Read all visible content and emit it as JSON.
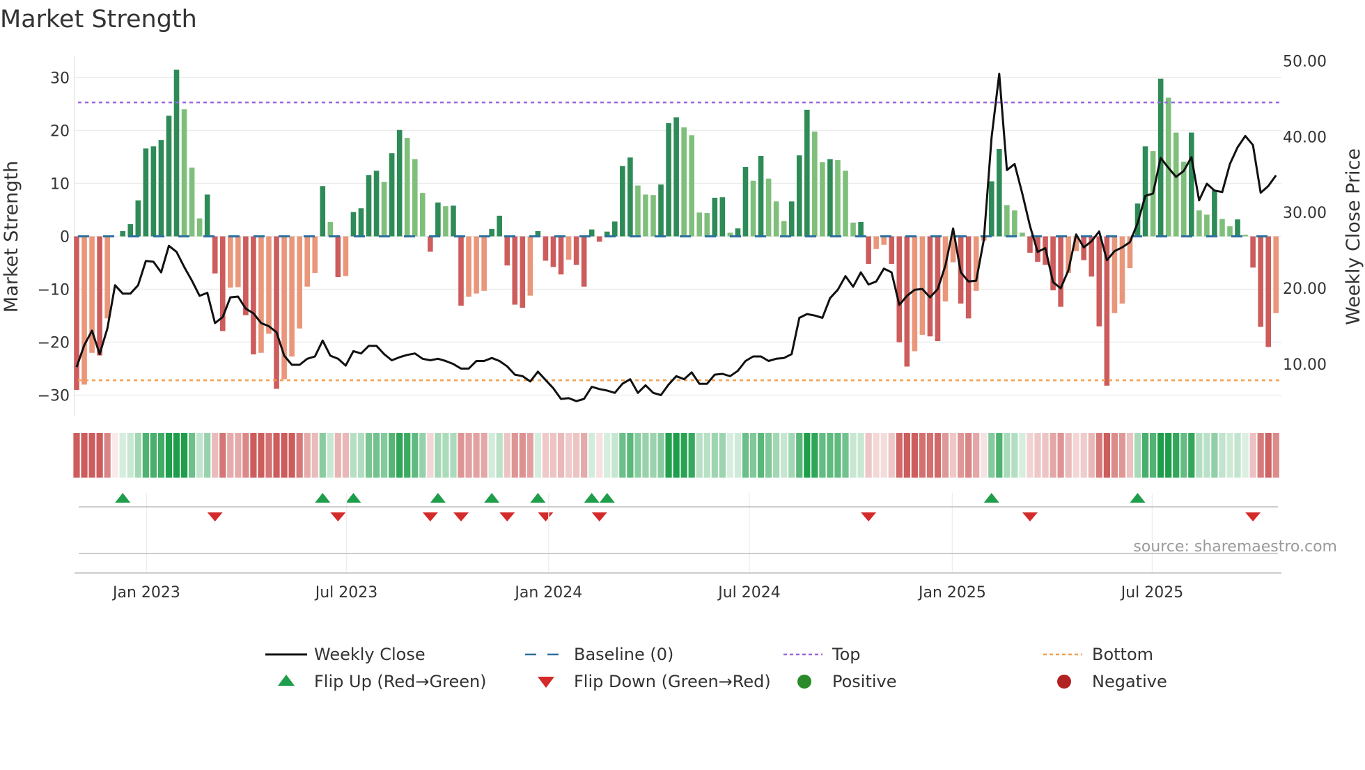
{
  "title": "Market Strength",
  "source": "source: sharemaestro.com",
  "chart_data": {
    "type": "bar",
    "title": "Market Strength",
    "ylabel": "Market Strength",
    "ylabel_right": "Weekly Close Price",
    "ylim": [
      -34,
      34
    ],
    "ylim_right": [
      3.1,
      50.6
    ],
    "grid": true,
    "left_ticks": [
      {
        "v": 30,
        "label": "30"
      },
      {
        "v": 20,
        "label": "20"
      },
      {
        "v": 10,
        "label": "10"
      },
      {
        "v": 0,
        "label": "0"
      },
      {
        "v": -10,
        "label": "−10"
      },
      {
        "v": -20,
        "label": "−20"
      },
      {
        "v": -30,
        "label": "−30"
      }
    ],
    "right_ticks": [
      {
        "v": 50,
        "label": "50.00"
      },
      {
        "v": 40,
        "label": "40.00"
      },
      {
        "v": 30,
        "label": "30.00"
      },
      {
        "v": 20,
        "label": "20.00"
      },
      {
        "v": 10,
        "label": "10.00"
      }
    ],
    "x_ticks": [
      {
        "week": 9.1,
        "label": "Jan 2023"
      },
      {
        "week": 35.1,
        "label": "Jul 2023"
      },
      {
        "week": 61.4,
        "label": "Jan 2024"
      },
      {
        "week": 87.5,
        "label": "Jul 2024"
      },
      {
        "week": 113.9,
        "label": "Jan 2025"
      },
      {
        "week": 139.9,
        "label": "Jul 2025"
      }
    ],
    "top_level": 25.3,
    "bottom_level": -27.2,
    "baseline": 0,
    "strength": [
      -29,
      -28,
      -22,
      -22.5,
      -15.5,
      0,
      1.0,
      2.3,
      6.8,
      16.6,
      17.0,
      18.2,
      22.8,
      31.5,
      24,
      13,
      3.4,
      7.9,
      -7,
      -17.9,
      -9.7,
      -9.6,
      -14.9,
      -22.3,
      -22,
      -18.4,
      -28.8,
      -27,
      -22.7,
      -17.4,
      -9.5,
      -6.9,
      9.5,
      2.7,
      -7.7,
      -7.5,
      4.6,
      5.3,
      11.6,
      12.4,
      10.3,
      15.7,
      20.1,
      18.6,
      14.6,
      8.2,
      -2.9,
      6.4,
      5.7,
      5.8,
      -13.1,
      -11.4,
      -10.8,
      -10.3,
      1.4,
      3.9,
      -5.5,
      -12.9,
      -13.5,
      -11.2,
      1.0,
      -4.6,
      -5.8,
      -7.2,
      -4.4,
      -5.4,
      -9.5,
      1.3,
      -1.0,
      0.9,
      2.8,
      13.3,
      14.9,
      9.6,
      7.9,
      7.8,
      9.8,
      21.4,
      22.5,
      20.6,
      19.1,
      4.5,
      4.4,
      7.3,
      7.4,
      0.7,
      1.5,
      13.1,
      10.5,
      15.2,
      10.9,
      6.6,
      2.9,
      6.6,
      15.3,
      23.9,
      19.8,
      14.0,
      14.6,
      14.4,
      12.4,
      2.6,
      2.7,
      -5.2,
      -2.4,
      -1.6,
      -5.2,
      -20,
      -24.6,
      -21.7,
      -18.6,
      -18.9,
      -19.8,
      -12.3,
      -4.9,
      -12.7,
      -15.5,
      -10.3,
      -0.8,
      10.4,
      16.5,
      5.9,
      4.9,
      0.7,
      -3.1,
      -4.8,
      -5.4,
      -10.2,
      -13.3,
      -6.9,
      -2.8,
      -4.5,
      -7.6,
      -17,
      -28.2,
      -14.5,
      -12.7,
      -6,
      6.2,
      17,
      16.1,
      29.8,
      26.2,
      19.6,
      14.1,
      19.6,
      4.9,
      4.1,
      8.7,
      3.3,
      1.9,
      3.2,
      0.3,
      -5.9,
      -17.1,
      -20.9,
      -14.5
    ],
    "weekly_close": [
      9.6,
      12.5,
      14.4,
      11.3,
      14.7,
      20.4,
      19.3,
      19.3,
      20.4,
      23.6,
      23.5,
      22.1,
      25.6,
      24.8,
      22.8,
      21.0,
      19.0,
      19.4,
      15.4,
      16.2,
      18.8,
      18.9,
      17.3,
      16.7,
      15.4,
      15.0,
      14.2,
      11.1,
      9.9,
      9.9,
      10.7,
      11.0,
      13.1,
      11.1,
      10.7,
      9.8,
      11.7,
      11.4,
      12.4,
      12.4,
      11.3,
      10.5,
      10.9,
      11.2,
      11.4,
      10.7,
      10.5,
      10.7,
      10.4,
      10.0,
      9.4,
      9.4,
      10.4,
      10.4,
      10.8,
      10.4,
      9.7,
      8.6,
      8.4,
      7.7,
      9.0,
      7.9,
      6.8,
      5.4,
      5.5,
      5.1,
      5.4,
      7.0,
      6.7,
      6.5,
      6.2,
      7.4,
      8.0,
      6.2,
      7.2,
      6.2,
      5.9,
      7.3,
      8.4,
      8.0,
      8.9,
      7.4,
      7.4,
      8.6,
      8.7,
      8.4,
      9.1,
      10.4,
      11.0,
      11.0,
      10.4,
      10.7,
      10.8,
      11.3,
      16.1,
      16.6,
      16.4,
      16.1,
      18.7,
      19.8,
      21.6,
      20.2,
      22.1,
      20.5,
      20.9,
      22.6,
      22.1,
      17.8,
      19.0,
      19.8,
      19.9,
      18.8,
      19.9,
      23.0,
      27.9,
      22.1,
      20.9,
      21.0,
      26.4,
      39.9,
      48.3,
      35.6,
      36.4,
      32.5,
      28.2,
      24.8,
      25.3,
      20.8,
      20.0,
      22.4,
      27.1,
      25.4,
      26.2,
      27.5,
      23.7,
      24.9,
      25.4,
      26.1,
      28.6,
      32.2,
      32.5,
      37.2,
      35.9,
      34.7,
      35.5,
      37.3,
      31.6,
      33.8,
      32.9,
      32.7,
      36.4,
      38.6,
      40.1,
      38.9,
      32.6,
      33.5,
      34.9
    ],
    "colors": {
      "strong_positive": "#2e8b57",
      "weak_positive": "#7fbf7b",
      "strong_negative": "#cd5c5c",
      "weak_negative": "#e9967a",
      "baseline": "#2b6f9e",
      "top": "#9966dd",
      "bottom": "#f0a050",
      "line": "#111111",
      "flip_up": "#1e9e4a",
      "flip_down": "#d42a2a"
    },
    "legend": [
      {
        "key": "weekly-close",
        "label": "Weekly Close"
      },
      {
        "key": "baseline",
        "label": "Baseline (0)"
      },
      {
        "key": "top",
        "label": "Top"
      },
      {
        "key": "bottom",
        "label": "Bottom"
      },
      {
        "key": "flip-up",
        "label": "Flip Up (Red→Green)"
      },
      {
        "key": "flip-down",
        "label": "Flip Down (Green→Red)"
      },
      {
        "key": "positive",
        "label": "Positive"
      },
      {
        "key": "negative",
        "label": "Negative"
      }
    ]
  }
}
